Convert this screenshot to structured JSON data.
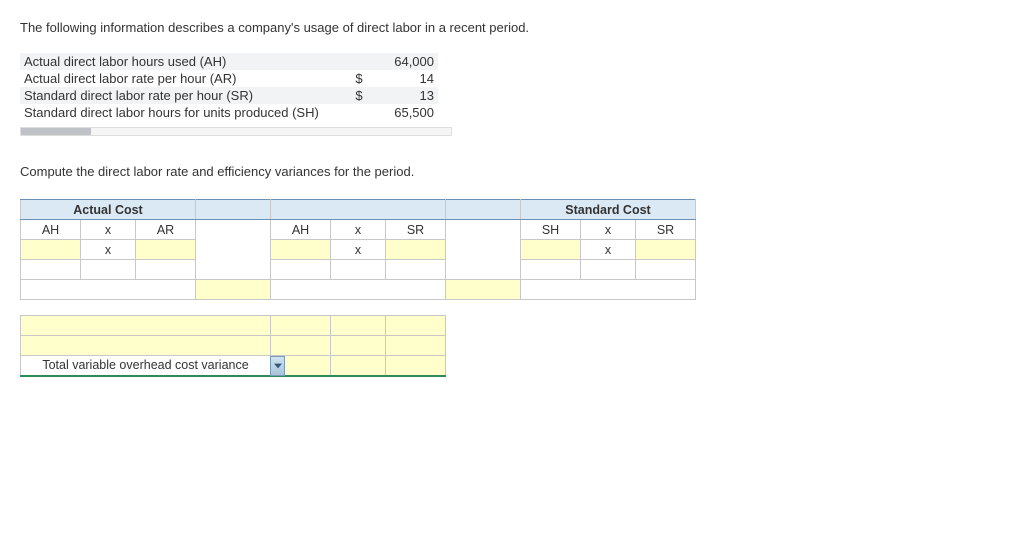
{
  "intro": "The following information describes a company's usage of direct labor in a recent period.",
  "info": {
    "rows": [
      {
        "label": "Actual direct labor hours used (AH)",
        "currency": "",
        "value": "64,000"
      },
      {
        "label": "Actual direct labor rate per hour (AR)",
        "currency": "$",
        "value": "14"
      },
      {
        "label": "Standard direct labor rate per hour (SR)",
        "currency": "$",
        "value": "13"
      },
      {
        "label": "Standard direct labor hours for units produced (SH)",
        "currency": "",
        "value": "65,500"
      }
    ]
  },
  "compute": "Compute the direct labor rate and efficiency variances for the period.",
  "sheet": {
    "actual_cost": "Actual Cost",
    "standard_cost": "Standard Cost",
    "ah": "AH",
    "ar": "AR",
    "sr": "SR",
    "sh": "SH",
    "times": "x",
    "total_label": "Total variable overhead cost variance"
  }
}
